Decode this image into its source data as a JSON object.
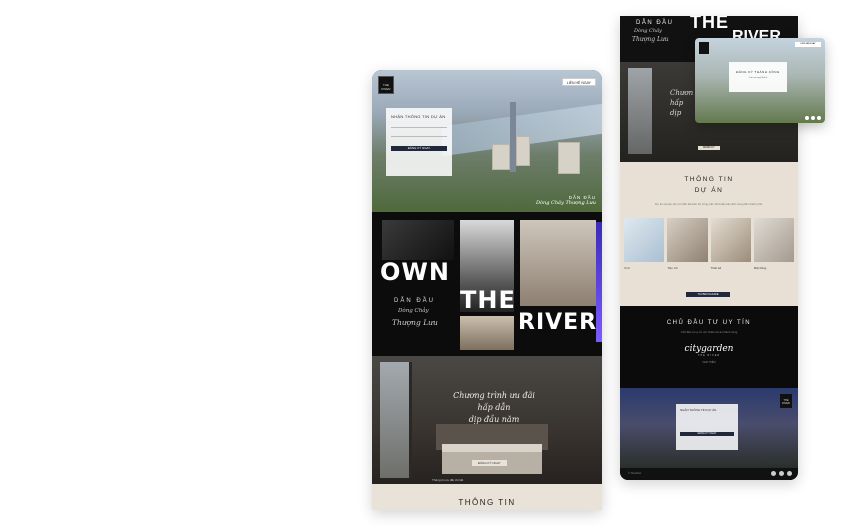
{
  "main": {
    "logo_text": "THE RIVER",
    "top_button": "LIÊN HỆ NGAY",
    "form_title": "NHẬN THÔNG TIN DỰ ÁN",
    "form_button": "ĐĂNG KÝ NGAY",
    "hero_caption_1": "DẪN ĐẦU",
    "hero_caption_2": "Dòng Chảy Thượng Lưu",
    "own_word": "OWN",
    "the_word": "THE",
    "river_word": "RIVER",
    "own_sub_1": "DẪN ĐẦU",
    "own_sub_2": "Dòng Chảy",
    "own_sub_3": "Thượng Lưu",
    "promo_title_1": "Chương trình ưu đãi",
    "promo_title_2": "hấp dẫn",
    "promo_title_3": "dịp đầu năm",
    "promo_button": "ĐĂNG KÝ NGAY",
    "promo_note": "Thông tin ưu đãi chi tiết",
    "info_title": "THÔNG TIN"
  },
  "side": {
    "top_1": "DẪN ĐẦU",
    "top_2": "Dòng Chảy",
    "top_3": "Thượng Lưu",
    "the_word": "THE",
    "river_word": "RIVER",
    "room_title_1": "Chươn",
    "room_title_2": "hấp",
    "room_title_3": "dịp",
    "room_button": "ĐĂNG KÝ",
    "info_title_1": "THÔNG TIN",
    "info_title_2": "DỰ ÁN",
    "info_desc": "Dự án tọa lạc tại vị trí đắc địa bên bờ sông, kết nối thuận tiện đến trung tâm thành phố.",
    "card_labels": [
      "Vị trí",
      "Tiện ích",
      "Thiết kế",
      "Mặt bằng"
    ],
    "info_button": "TẢI BROCHURE",
    "dev_title": "CHỦ ĐẦU TƯ UY TÍN",
    "dev_desc": "Chủ đầu tư uy tín với nhiều dự án thành công",
    "dev_logo": "citygarden",
    "dev_logo_sub": "THE RIVER",
    "dev_link": "XEM THÊM",
    "villa_card_title": "NHẬN THÔNG TIN DỰ ÁN",
    "villa_card_button": "ĐĂNG KÝ NGAY",
    "villa_logo": "THE RIVER",
    "footer_text": "© The River"
  },
  "popup": {
    "top_button": "LIÊN HỆ NGAY",
    "dialog_title": "ĐĂNG KÝ THÀNH CÔNG",
    "dialog_desc": "Cảm ơn quý khách"
  },
  "colors": {
    "navy_button": "#20283a",
    "cream": "#e9e2d8",
    "black": "#0c0c0c"
  }
}
